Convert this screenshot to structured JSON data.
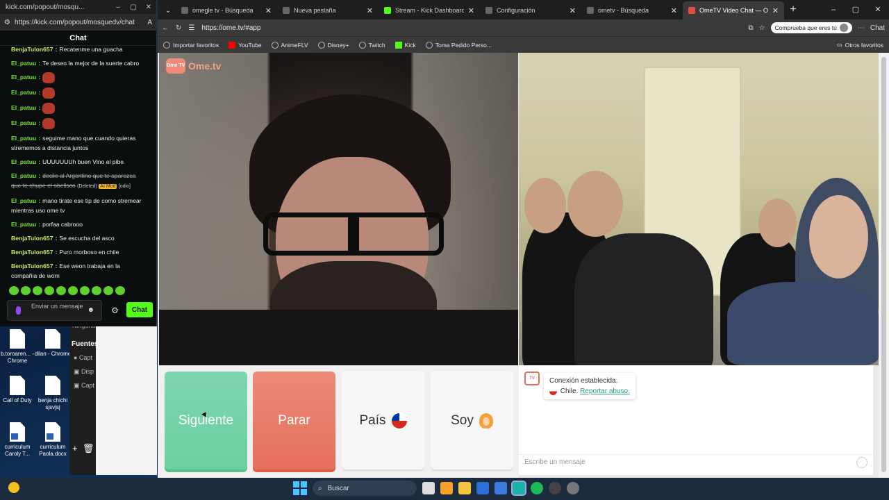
{
  "chat_window": {
    "title": "kick.com/popout/mosqu...",
    "url": "https://kick.com/popout/mosquedv/chat",
    "header": "Chat",
    "messages": [
      {
        "user": "BenjaTulon657",
        "text": "Recatenme una guacha",
        "color": "b"
      },
      {
        "user": "El_patuu",
        "text": "Te deseo la mejor de la suerte cabro",
        "color": "g"
      },
      {
        "user": "El_patuu",
        "text": "",
        "emote": true,
        "color": "g"
      },
      {
        "user": "El_patuu",
        "text": "",
        "emote": true,
        "color": "g"
      },
      {
        "user": "El_patuu",
        "text": "",
        "emote": true,
        "color": "g"
      },
      {
        "user": "El_patuu",
        "text": "",
        "emote": true,
        "color": "g"
      },
      {
        "user": "El_patuu",
        "text": "seguime mano que cuando quieras strememos a distancia juntos",
        "color": "g"
      },
      {
        "user": "El_patuu",
        "text": "UUUUUUUh buen Vino el pibe",
        "color": "g"
      },
      {
        "user": "El_patuu",
        "text": "decile al Argentino que te aparezca que te chupe el obelisco",
        "color": "g",
        "deleted": true,
        "deleted_label": "(Deleted)",
        "mod_label": "AI Mod",
        "odio_label": "[odio]"
      },
      {
        "user": "El_patuu",
        "text": "mano tirate ese tip de como stremear mientras uso ome tv",
        "color": "g"
      },
      {
        "user": "El_patuu",
        "text": "porfaa cabrooo",
        "color": "g"
      },
      {
        "user": "BenjaTulon657",
        "text": "Se escucha del asco",
        "color": "b"
      },
      {
        "user": "BenjaTulon657",
        "text": "Puro morboso en chile",
        "color": "b"
      },
      {
        "user": "BenjaTulon657",
        "text": "Ese weon trabaja en la compañia de wom",
        "color": "b"
      }
    ],
    "input_placeholder": "Enviar un mensaje",
    "send_label": "Chat"
  },
  "explorer": {
    "ghost": "Ninguna",
    "sources_label": "Fuentes",
    "sources": [
      "Capt",
      "Disp",
      "Capt"
    ]
  },
  "desktop_icons": [
    {
      "label": "b.toroaren... - Chrome"
    },
    {
      "label": "dilan - Chrome"
    },
    {
      "label": "Call of Duty"
    },
    {
      "label": "benja chichi sjsvjsj"
    },
    {
      "label": "curriculum Caroly T..."
    },
    {
      "label": "curriculum Paola.docx"
    }
  ],
  "browser": {
    "tabs": [
      {
        "label": "omegle tv - Búsqueda",
        "icon": "search-icon"
      },
      {
        "label": "Nueva pestaña",
        "icon": "page-icon"
      },
      {
        "label": "Stream - Kick Dashboard",
        "icon": "kick-icon"
      },
      {
        "label": "Configuración",
        "icon": "gear-icon"
      },
      {
        "label": "ometv - Búsqueda",
        "icon": "search-icon"
      },
      {
        "label": "OmeTV Video Chat — On",
        "icon": "ometv-icon",
        "active": true
      }
    ],
    "address": "https://ome.tv/#app",
    "profile_pill": "Comprueba que eres tú",
    "chat_label": "Chat",
    "bookmarks": [
      {
        "label": "Importar favoritos"
      },
      {
        "label": "YouTube"
      },
      {
        "label": "AnimeFLV"
      },
      {
        "label": "Disney+"
      },
      {
        "label": "Twitch"
      },
      {
        "label": "Kick"
      },
      {
        "label": "Toma Pedido Perso..."
      }
    ],
    "other_favorites": "Otros favoritos"
  },
  "ometv": {
    "logo_text": "Ome.tv",
    "logo_badge": "Ome TV",
    "buttons": {
      "next": "Siguiente",
      "stop": "Parar",
      "country": "País",
      "gender": "Soy"
    },
    "system_message": {
      "line1": "Conexión establecida.",
      "country": "Chile.",
      "report": "Reportar abuso."
    },
    "message_placeholder": "Escribe un mensaje"
  },
  "taskbar": {
    "search_placeholder": "Buscar"
  },
  "colors": {
    "kick_green": "#53fc18",
    "next_green": "#6ccf9f",
    "stop_red": "#e5705c",
    "ometv_accent": "#e86b56"
  }
}
